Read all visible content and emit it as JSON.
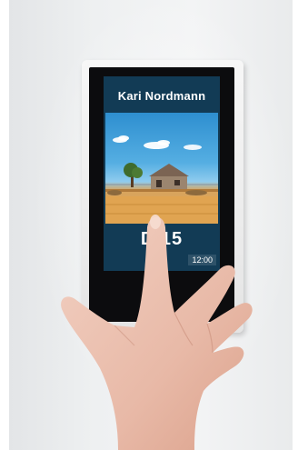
{
  "device": {
    "occupant_name": "Kari Nordmann",
    "room_label": "D 15",
    "time_label": "12:00"
  },
  "scene": {
    "description_icon": "farmhouse-landscape-image"
  },
  "colors": {
    "panel_background": "#123b55",
    "sky": "#4aa6dd",
    "ground": "#e2a750"
  }
}
